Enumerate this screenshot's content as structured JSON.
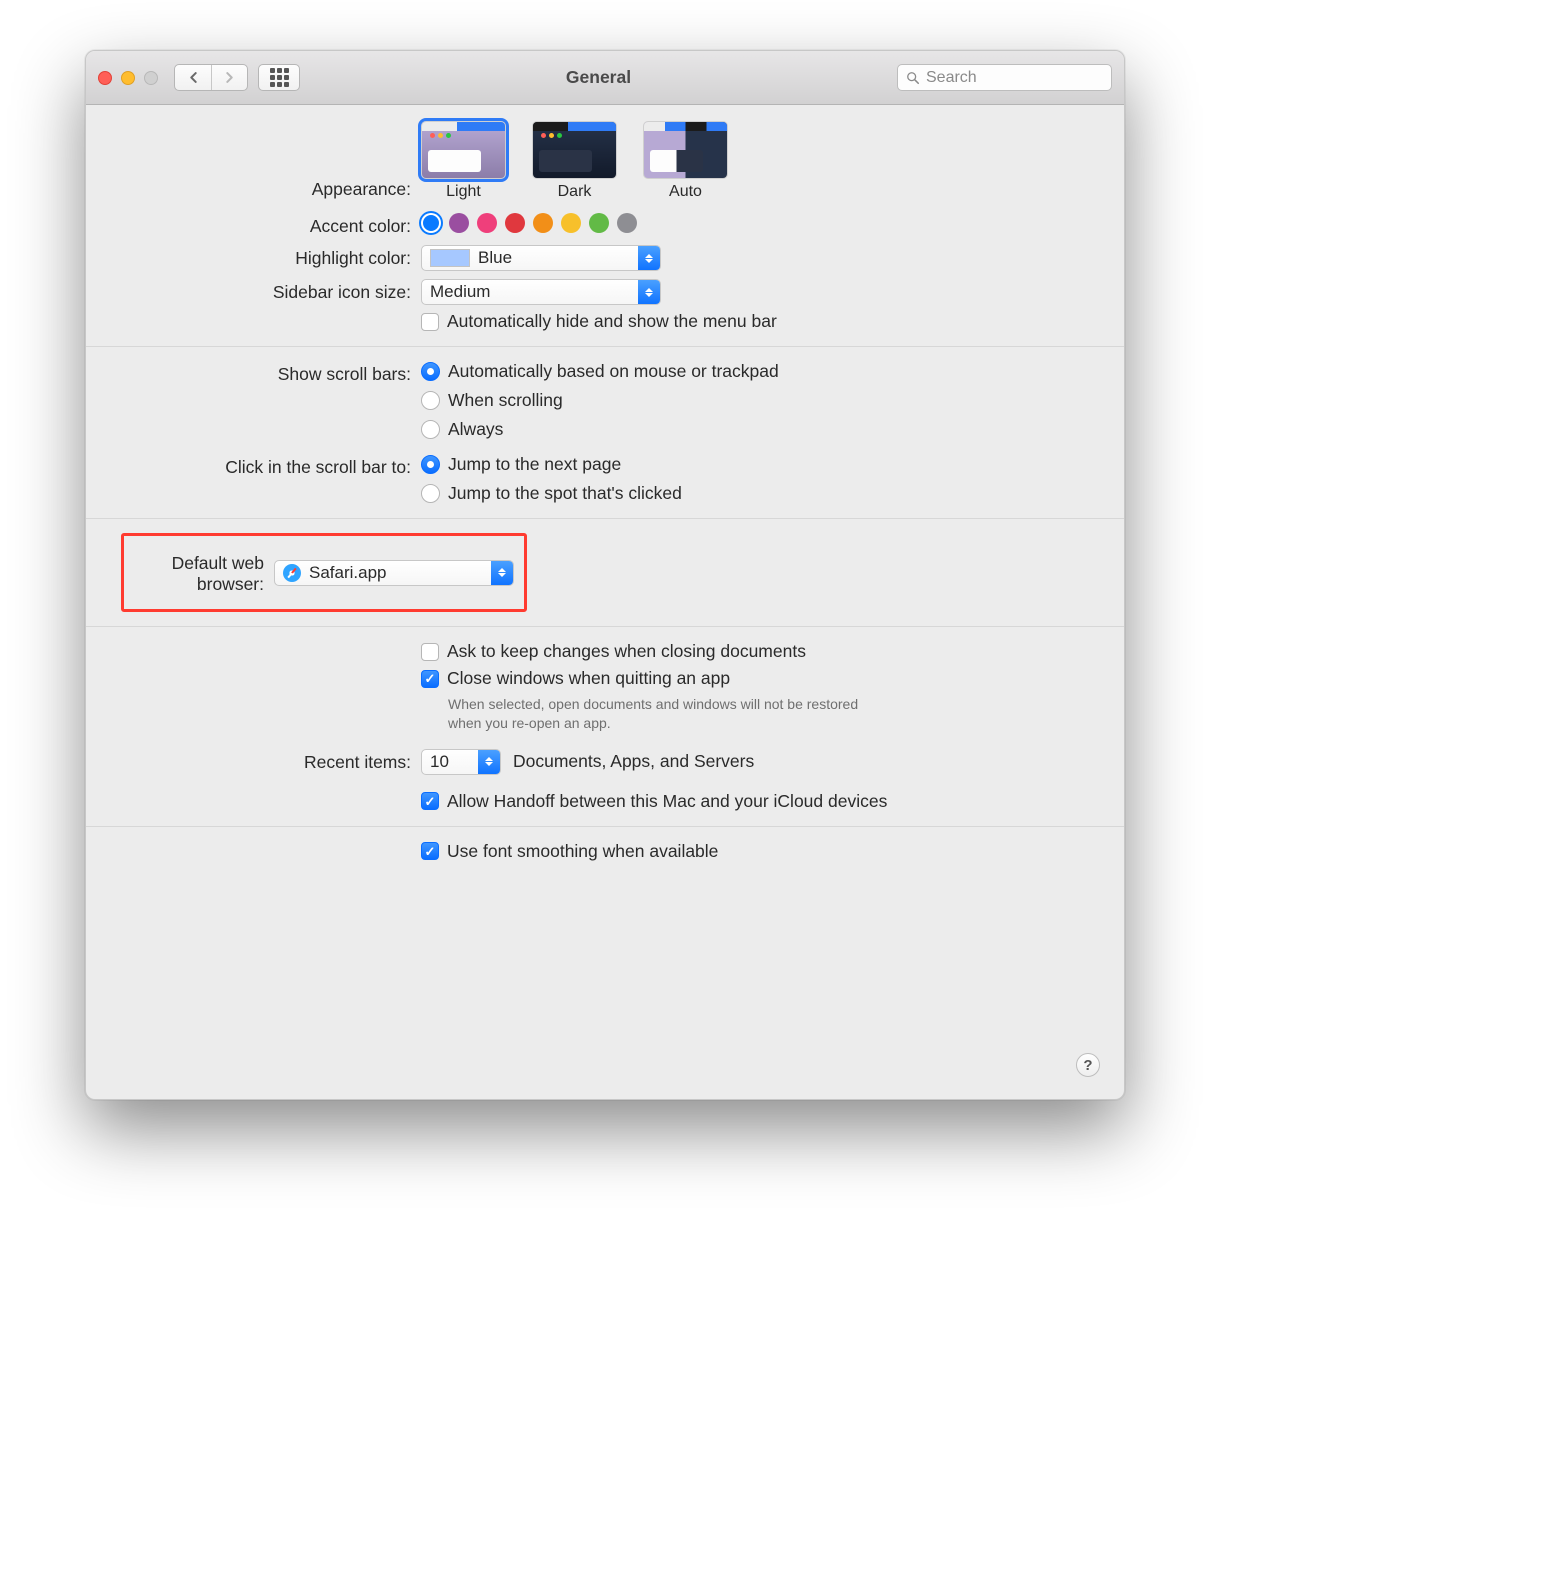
{
  "window": {
    "title": "General"
  },
  "toolbar": {
    "search_placeholder": "Search"
  },
  "appearance": {
    "label": "Appearance:",
    "options": [
      "Light",
      "Dark",
      "Auto"
    ],
    "selected": "Light"
  },
  "accent": {
    "label": "Accent color:",
    "colors": [
      "#0a7aff",
      "#9a4ea0",
      "#ef3f7b",
      "#e0383e",
      "#f28f18",
      "#f7c02b",
      "#62ba46",
      "#8e8e93"
    ],
    "selected_index": 0
  },
  "highlight": {
    "label": "Highlight color:",
    "value": "Blue"
  },
  "sidebar_size": {
    "label": "Sidebar icon size:",
    "value": "Medium"
  },
  "menubar_hide": {
    "label": "Automatically hide and show the menu bar",
    "checked": false
  },
  "scrollbars": {
    "label": "Show scroll bars:",
    "options": [
      "Automatically based on mouse or trackpad",
      "When scrolling",
      "Always"
    ],
    "selected_index": 0
  },
  "click_scroll": {
    "label": "Click in the scroll bar to:",
    "options": [
      "Jump to the next page",
      "Jump to the spot that's clicked"
    ],
    "selected_index": 0
  },
  "default_browser": {
    "label": "Default web browser:",
    "value": "Safari.app"
  },
  "ask_keep": {
    "label": "Ask to keep changes when closing documents",
    "checked": false
  },
  "close_windows": {
    "label": "Close windows when quitting an app",
    "checked": true,
    "hint": "When selected, open documents and windows will not be restored when you re-open an app."
  },
  "recent": {
    "label": "Recent items:",
    "value": "10",
    "suffix": "Documents, Apps, and Servers"
  },
  "handoff": {
    "label": "Allow Handoff between this Mac and your iCloud devices",
    "checked": true
  },
  "font_smoothing": {
    "label": "Use font smoothing when available",
    "checked": true
  },
  "help": "?"
}
